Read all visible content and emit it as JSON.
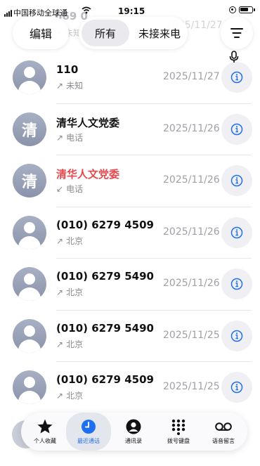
{
  "status_bar": {
    "carrier": "中国移动全球通",
    "time": "19:15"
  },
  "ghost_row": {
    "name": "669 0",
    "sub": "↗ 未知",
    "date": "2025/11/27"
  },
  "header": {
    "edit_label": "编辑",
    "tab_all_label": "所有",
    "tab_missed_label": "未接来电"
  },
  "calls": [
    {
      "name": "110",
      "arrow": "↗",
      "sub": "未知",
      "date": "2025/11/27",
      "avatar": "person",
      "missed": false
    },
    {
      "name": "清华人文党委",
      "arrow": "↗",
      "sub": "电话",
      "date": "2025/11/26",
      "avatar": "清",
      "missed": false
    },
    {
      "name": "清华人文党委",
      "arrow": "↙",
      "sub": "电话",
      "date": "2025/11/26",
      "avatar": "清",
      "missed": true
    },
    {
      "name": "(010) 6279 4509",
      "arrow": "↗",
      "sub": "北京",
      "date": "2025/11/26",
      "avatar": "person",
      "missed": false
    },
    {
      "name": "(010) 6279 5490",
      "arrow": "↗",
      "sub": "北京",
      "date": "2025/11/26",
      "avatar": "person",
      "missed": false
    },
    {
      "name": "(010) 6279 5490",
      "arrow": "↗",
      "sub": "北京",
      "date": "2025/11/25",
      "avatar": "person",
      "missed": false
    },
    {
      "name": "(010) 6279 4509",
      "arrow": "↗",
      "sub": "北京",
      "date": "2025/11/25",
      "avatar": "person",
      "missed": false
    }
  ],
  "tabbar": {
    "favorites": "个人收藏",
    "recents": "最近通话",
    "contacts": "通讯录",
    "keypad": "拨号键盘",
    "voicemail": "语音留言"
  },
  "colors": {
    "accent": "#1e6ff1",
    "missed": "#e5484d",
    "secondary_text": "#8a8a8f"
  },
  "icons": [
    "signal-icon",
    "wifi-icon",
    "location-icon",
    "battery-icon",
    "filter-icon",
    "microphone-icon",
    "info-icon",
    "star-icon",
    "clock-icon",
    "person-circle-icon",
    "keypad-icon",
    "voicemail-icon"
  ]
}
